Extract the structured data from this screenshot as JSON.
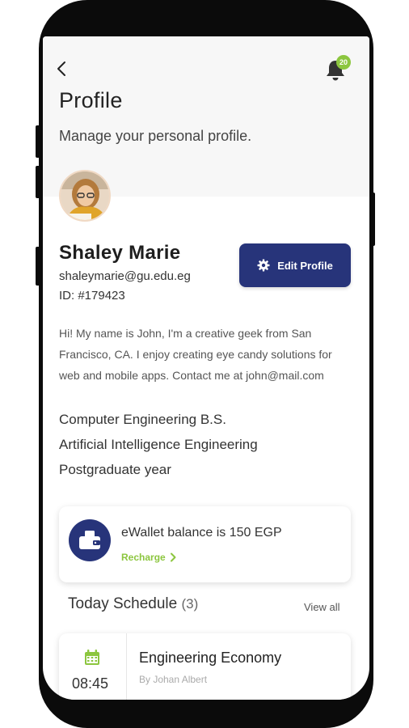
{
  "header": {
    "title": "Profile",
    "subtitle": "Manage your personal profile."
  },
  "notifications": {
    "count": "20",
    "icon": "bell-icon"
  },
  "user": {
    "name": "Shaley Marie",
    "email": "shaleymarie@gu.edu.eg",
    "id": "ID: #179423",
    "bio": "Hi! My name is John, I'm a creative geek from San Francisco, CA. I enjoy creating eye candy solutions for web and mobile apps. Contact me at john@mail.com",
    "education": [
      "Computer Engineering B.S.",
      "Artificial Intelligence Engineering",
      "Postgraduate year"
    ]
  },
  "edit_button": {
    "label": "Edit Profile",
    "icon": "gear-icon"
  },
  "wallet": {
    "text": "eWallet balance is 150 EGP",
    "recharge_label": "Recharge",
    "icon": "wallet-icon"
  },
  "schedule": {
    "title": "Today Schedule",
    "count": "(3)",
    "view_all_label": "View all",
    "items": [
      {
        "time": "08:45",
        "course": "Engineering Economy",
        "teacher": "By Johan Albert"
      }
    ]
  },
  "colors": {
    "primary": "#27347a",
    "accent": "#8cc63f",
    "header_bg": "#f7f7f7"
  }
}
